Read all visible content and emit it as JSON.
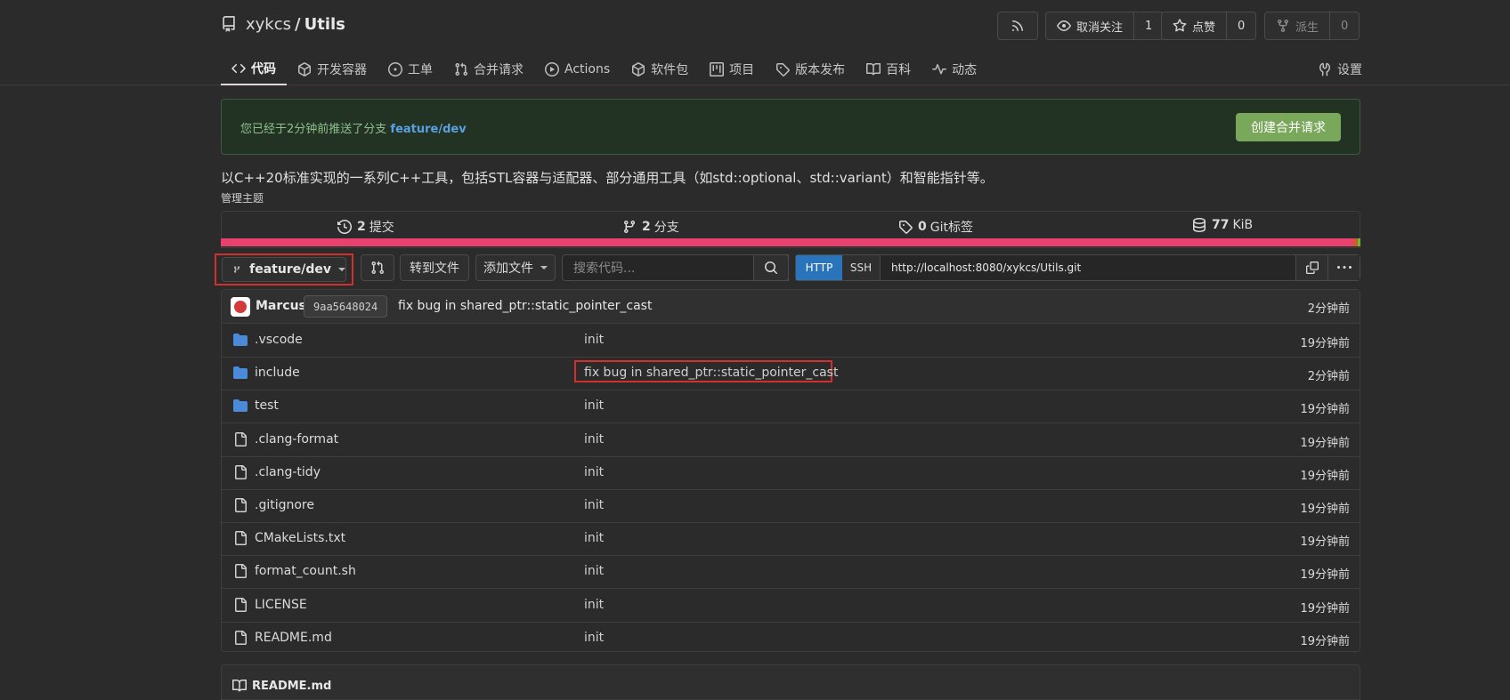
{
  "repo": {
    "owner": "xykcs",
    "separator": "/",
    "name": "Utils"
  },
  "header_buttons": {
    "unwatch_label": "取消关注",
    "watch_count": "1",
    "star_label": "点赞",
    "star_count": "0",
    "fork_label": "派生",
    "fork_count": "0"
  },
  "tabs": [
    {
      "label": "代码",
      "icon": "code-icon",
      "active": true
    },
    {
      "label": "开发容器",
      "icon": "package-icon"
    },
    {
      "label": "工单",
      "icon": "issue-icon"
    },
    {
      "label": "合并请求",
      "icon": "pull-request-icon"
    },
    {
      "label": "Actions",
      "icon": "play-icon"
    },
    {
      "label": "软件包",
      "icon": "package-icon"
    },
    {
      "label": "项目",
      "icon": "project-icon"
    },
    {
      "label": "版本发布",
      "icon": "tag-icon"
    },
    {
      "label": "百科",
      "icon": "book-icon"
    },
    {
      "label": "动态",
      "icon": "pulse-icon"
    }
  ],
  "settings_label": "设置",
  "banner": {
    "message": "您已经于2分钟前推送了分支",
    "branch": "feature/dev",
    "button": "创建合并请求"
  },
  "description": "以C++20标准实现的一系列C++工具，包括STL容器与适配器、部分通用工具（如std::optional、std::variant）和智能指针等。",
  "manage_topics": "管理主题",
  "stats": {
    "commits_count": "2",
    "commits_label": "提交",
    "branches_count": "2",
    "branches_label": "分支",
    "tags_count": "0",
    "tags_label": "Git标签",
    "size": "77",
    "size_unit": "KiB"
  },
  "colors": {
    "accent": "#2a74bb",
    "banner_button": "#79a85b",
    "highlight": "#d32f2f",
    "lang_primary": "#e7416d"
  },
  "toolbar": {
    "branch": "feature/dev",
    "goto_file": "转到文件",
    "add_file": "添加文件",
    "search_placeholder": "搜索代码...",
    "http": "HTTP",
    "ssh": "SSH",
    "clone_url": "http://localhost:8080/xykcs/Utils.git"
  },
  "latest_commit": {
    "author": "Marcus",
    "sha": "9aa5648024",
    "message": "fix bug in shared_ptr::static_pointer_cast",
    "time": "2分钟前"
  },
  "files": [
    {
      "name": ".vscode",
      "type": "folder",
      "message": "init",
      "time": "19分钟前"
    },
    {
      "name": "include",
      "type": "folder",
      "message": "fix bug in shared_ptr::static_pointer_cast",
      "time": "2分钟前",
      "highlight": true
    },
    {
      "name": "test",
      "type": "folder",
      "message": "init",
      "time": "19分钟前"
    },
    {
      "name": ".clang-format",
      "type": "file",
      "message": "init",
      "time": "19分钟前"
    },
    {
      "name": ".clang-tidy",
      "type": "file",
      "message": "init",
      "time": "19分钟前"
    },
    {
      "name": ".gitignore",
      "type": "file",
      "message": "init",
      "time": "19分钟前"
    },
    {
      "name": "CMakeLists.txt",
      "type": "file",
      "message": "init",
      "time": "19分钟前"
    },
    {
      "name": "format_count.sh",
      "type": "file",
      "message": "init",
      "time": "19分钟前"
    },
    {
      "name": "LICENSE",
      "type": "file",
      "message": "init",
      "time": "19分钟前"
    },
    {
      "name": "README.md",
      "type": "file",
      "message": "init",
      "time": "19分钟前"
    }
  ],
  "readme_title": "README.md"
}
